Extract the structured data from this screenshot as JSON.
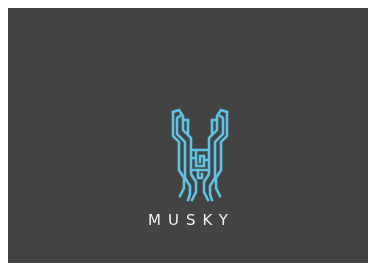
{
  "brand": {
    "name": "MUSKY",
    "logo_icon": "stag-antler-monogram-icon",
    "logo_color": "#5ec3e3",
    "text_color": "#f4f4f4",
    "background_color": "#434343"
  }
}
